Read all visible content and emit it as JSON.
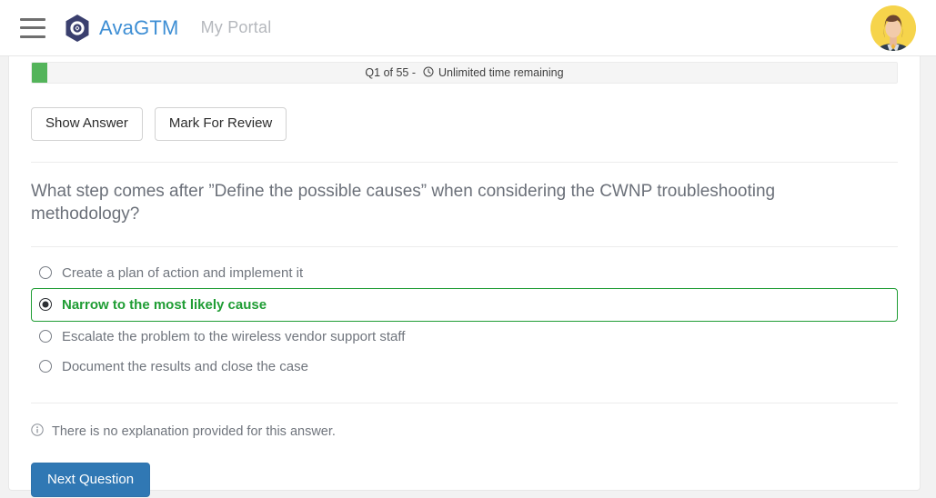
{
  "navbar": {
    "menu_icon": "hamburger-menu-icon",
    "logo_icon": "avagtm-logo-icon",
    "brand": "AvaGTM",
    "portal": "My Portal",
    "avatar_icon": "user-avatar",
    "brand_color": "#3d8ed4",
    "portal_color": "#b5b8bd",
    "logo_color": "#3a3f6e"
  },
  "quiz": {
    "progress": {
      "label": "Q1 of 55  -  Unlimited time remaining",
      "question_counter": "Q1 of 55",
      "separator": "-",
      "time_text": "Unlimited time remaining",
      "clock_icon": "clock-icon",
      "percent": 1.8,
      "fill_color": "#53b45a"
    },
    "actions": {
      "show_answer": "Show Answer",
      "mark_for_review": "Mark For Review"
    },
    "question_text": "What step comes after ”Define the possible causes” when considering the CWNP troubleshooting methodology?",
    "options": [
      {
        "label": "Create a plan of action and implement it",
        "selected": false
      },
      {
        "label": "Narrow to the most likely cause",
        "selected": true
      },
      {
        "label": "Escalate the problem to the wireless vendor support staff",
        "selected": false
      },
      {
        "label": "Document the results and close the case",
        "selected": false
      }
    ],
    "explanation": {
      "icon": "info-circle-icon",
      "text": "There is no explanation provided for this answer."
    },
    "next_button": "Next Question",
    "selected_color": "#1f9d34",
    "primary_color": "#3078b4"
  }
}
